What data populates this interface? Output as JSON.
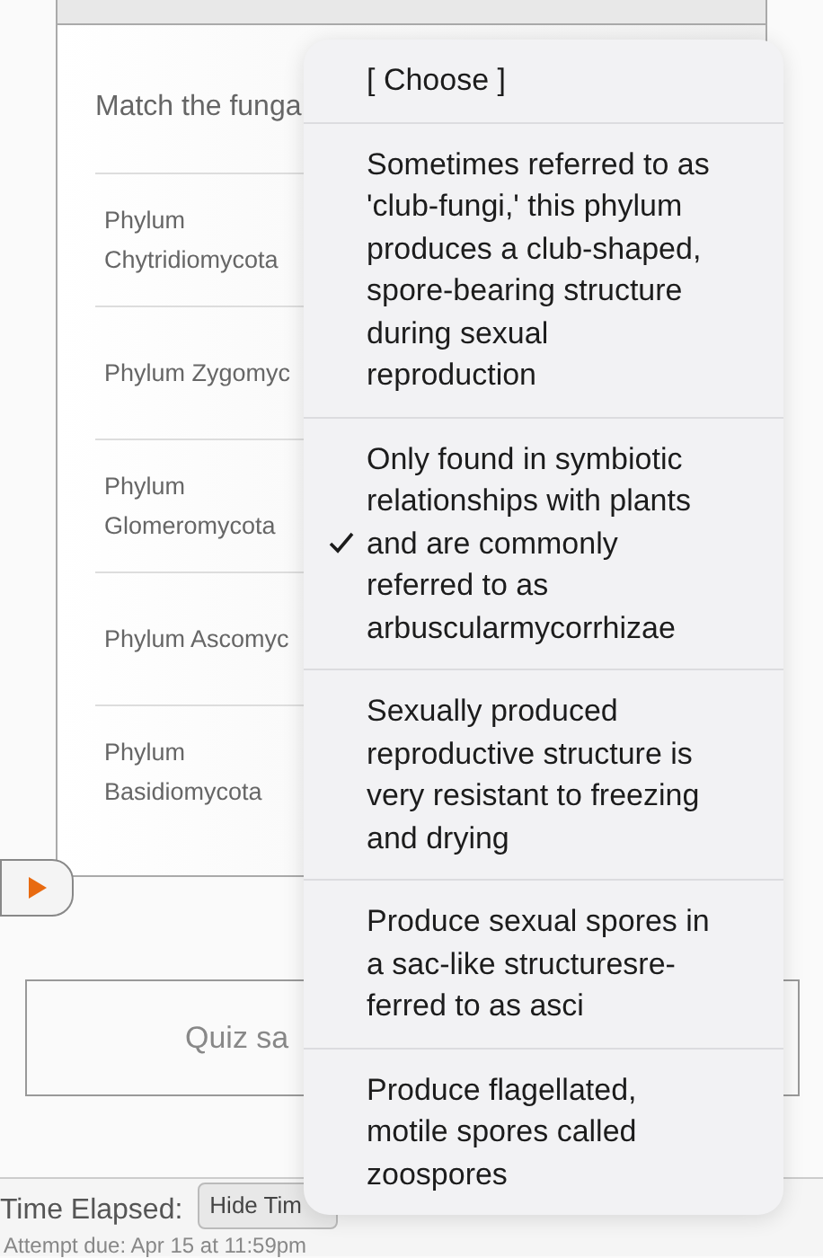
{
  "page": {
    "question_prompt": "Match the funga",
    "rows": [
      {
        "label": "Phylum Chytridiomycota"
      },
      {
        "label": "Phylum Zygomyc"
      },
      {
        "label": "Phylum Glomeromycota"
      },
      {
        "label": "Phylum Ascomyc"
      },
      {
        "label": "Phylum Basidiomycota"
      }
    ],
    "quiz_status": "Quiz sa",
    "timer": {
      "label": "Time Elapsed:",
      "button": "Hide Tim"
    },
    "due": "Attempt due: Apr 15 at 11:59pm"
  },
  "dropdown": {
    "options": [
      {
        "label": "[ Choose ]",
        "selected": false
      },
      {
        "label": "Sometimes referred to as 'club-fungi,' this phylum produces a club-shaped, spore-bearing structure during sexual reproduction",
        "selected": false
      },
      {
        "label": "Only found in symbiotic relationships with plants and are commonly referred to as arbuscularmycorrhizae",
        "selected": true
      },
      {
        "label": "Sexually produced reproductive structure is very resistant to freezing and drying",
        "selected": false
      },
      {
        "label": "Produce sexual spores in a sac-like structuresre-ferred to as asci",
        "selected": false
      },
      {
        "label": "Produce flagellated, motile spores called zoospores",
        "selected": false
      }
    ]
  }
}
